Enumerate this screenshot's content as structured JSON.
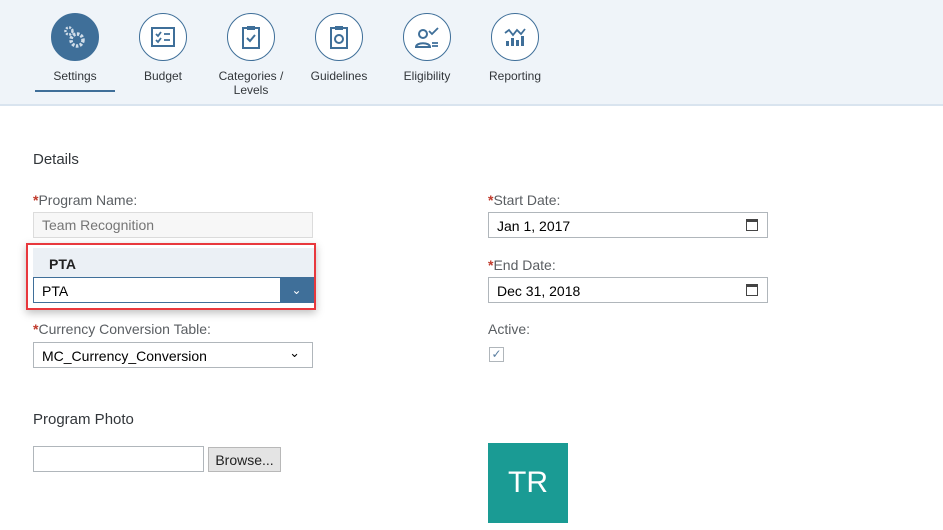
{
  "nav": {
    "tabs": [
      {
        "label": "Settings",
        "icon": "gears-icon",
        "active": true
      },
      {
        "label": "Budget",
        "icon": "checklist-icon"
      },
      {
        "label": "Categories / Levels",
        "icon": "clipboard-check-icon"
      },
      {
        "label": "Guidelines",
        "icon": "clipboard-target-icon"
      },
      {
        "label": "Eligibility",
        "icon": "person-check-icon"
      },
      {
        "label": "Reporting",
        "icon": "chart-icon"
      }
    ]
  },
  "details": {
    "heading": "Details",
    "program_name_label": "Program Name:",
    "program_name_placeholder": "Team Recognition",
    "dropdown_option": "PTA",
    "dropdown_value": "PTA",
    "currency_label": "Currency Conversion Table:",
    "currency_value": "MC_Currency_Conversion",
    "start_label": "Start Date:",
    "start_value": "Jan 1, 2017",
    "end_label": "End Date:",
    "end_value": "Dec 31, 2018",
    "active_label": "Active:",
    "active_checked": true,
    "required_mark": "*"
  },
  "photo": {
    "heading": "Program Photo",
    "browse_label": "Browse...",
    "avatar_initials": "TR",
    "avatar_color": "#1a9b94"
  }
}
